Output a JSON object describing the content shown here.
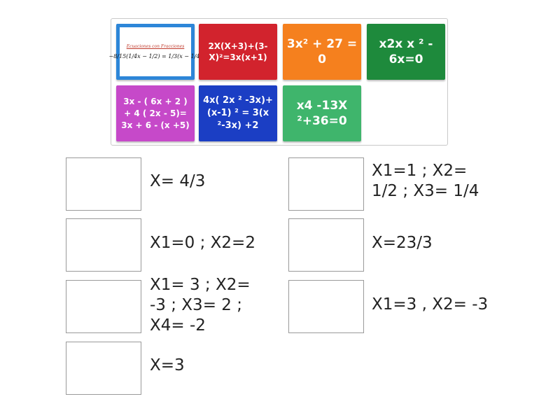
{
  "cards": {
    "image_card": {
      "title": "Ecuaciones con Fracciones",
      "expression": "−8/15(1/4x − 1/2) = 1/3(x − 1/4)"
    },
    "red": "2X(X+3)+(3-X)²=3x(x+1)",
    "orange": "3x² + 27 = 0",
    "green": "x2x x ² - 6x=0",
    "purple": "3x - ( 6x + 2 ) + 4 ( 2x - 5)= 3x + 6 - (x +5)",
    "blue": "4x( 2x ² -3x)+(x-1) ² = 3(x ²-3x) +2",
    "light_green": "x4 -13X ²+36=0"
  },
  "answers": [
    {
      "label": "X= 4/3"
    },
    {
      "label": "X1=1 ; X2= 1/2 ; X3= 1/4"
    },
    {
      "label": "X1=0 ; X2=2"
    },
    {
      "label": "X=23/3"
    },
    {
      "label": "X1= 3 ; X2= -3 ; X3= 2 ; X4= -2"
    },
    {
      "label": "X1=3 , X2= -3"
    },
    {
      "label": "X=3"
    }
  ],
  "colors": {
    "red": "#d2232d",
    "orange": "#f5801e",
    "green": "#1e8a3c",
    "purple": "#c649c9",
    "blue": "#1b3ec4",
    "light_green": "#3fb56c",
    "image_border": "#2d86d8"
  }
}
